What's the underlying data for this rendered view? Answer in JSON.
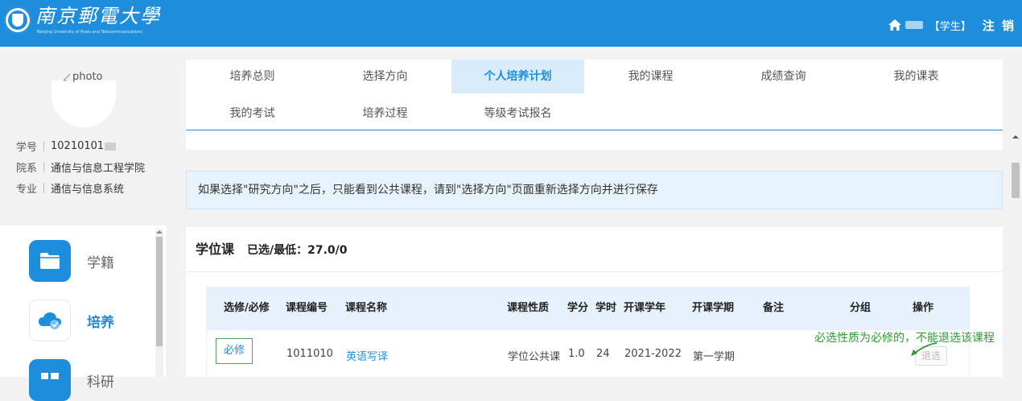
{
  "header": {
    "logo_title": "南京郵電大學",
    "logo_subtitle": "Nanjing University of Posts and Telecommunications",
    "role": "【学生】",
    "logout_label": "注 销"
  },
  "profile": {
    "photo_alt": "photo",
    "fields": [
      {
        "key": "学号",
        "value": "10210101"
      },
      {
        "key": "院系",
        "value": "通信与信息工程学院"
      },
      {
        "key": "专业",
        "value": "通信与信息系统"
      }
    ]
  },
  "sidebar": {
    "items": [
      {
        "label": "学籍",
        "icon": "folder-icon",
        "active": false
      },
      {
        "label": "培养",
        "icon": "cloud-check-icon",
        "active": true
      },
      {
        "label": "科研",
        "icon": "dashboard-icon",
        "active": false
      }
    ]
  },
  "tabs": [
    {
      "label": "培养总则",
      "active": false
    },
    {
      "label": "选择方向",
      "active": false
    },
    {
      "label": "个人培养计划",
      "active": true
    },
    {
      "label": "我的课程",
      "active": false
    },
    {
      "label": "成绩查询",
      "active": false
    },
    {
      "label": "我的课表",
      "active": false
    },
    {
      "label": "我的考试",
      "active": false
    },
    {
      "label": "培养过程",
      "active": false
    },
    {
      "label": "等级考试报名",
      "active": false
    }
  ],
  "notice": "如果选择\"研究方向\"之后，只能看到公共课程，请到\"选择方向\"页面重新选择方向并进行保存",
  "degree_courses": {
    "title": "学位课",
    "selected_min": "已选/最低：27.0/0",
    "columns": [
      "选修/必修",
      "课程编号",
      "课程名称",
      "课程性质",
      "学分",
      "学时",
      "开课学年",
      "开课学期",
      "备注",
      "分组",
      "操作"
    ],
    "rows": [
      {
        "type": "必修",
        "code": "1011010",
        "name": "英语写译",
        "nature": "学位公共课",
        "credit": "1.0",
        "hours": "24",
        "year": "2021-2022",
        "term": "第一学期",
        "note": "",
        "group": "",
        "action": "退选"
      }
    ]
  },
  "annotation": "必选性质为必修的，不能退选该课程",
  "colors": {
    "brand": "#1e8ddc",
    "annotation": "#2f9a33",
    "active_tab_bg": "#d9ecfb"
  }
}
